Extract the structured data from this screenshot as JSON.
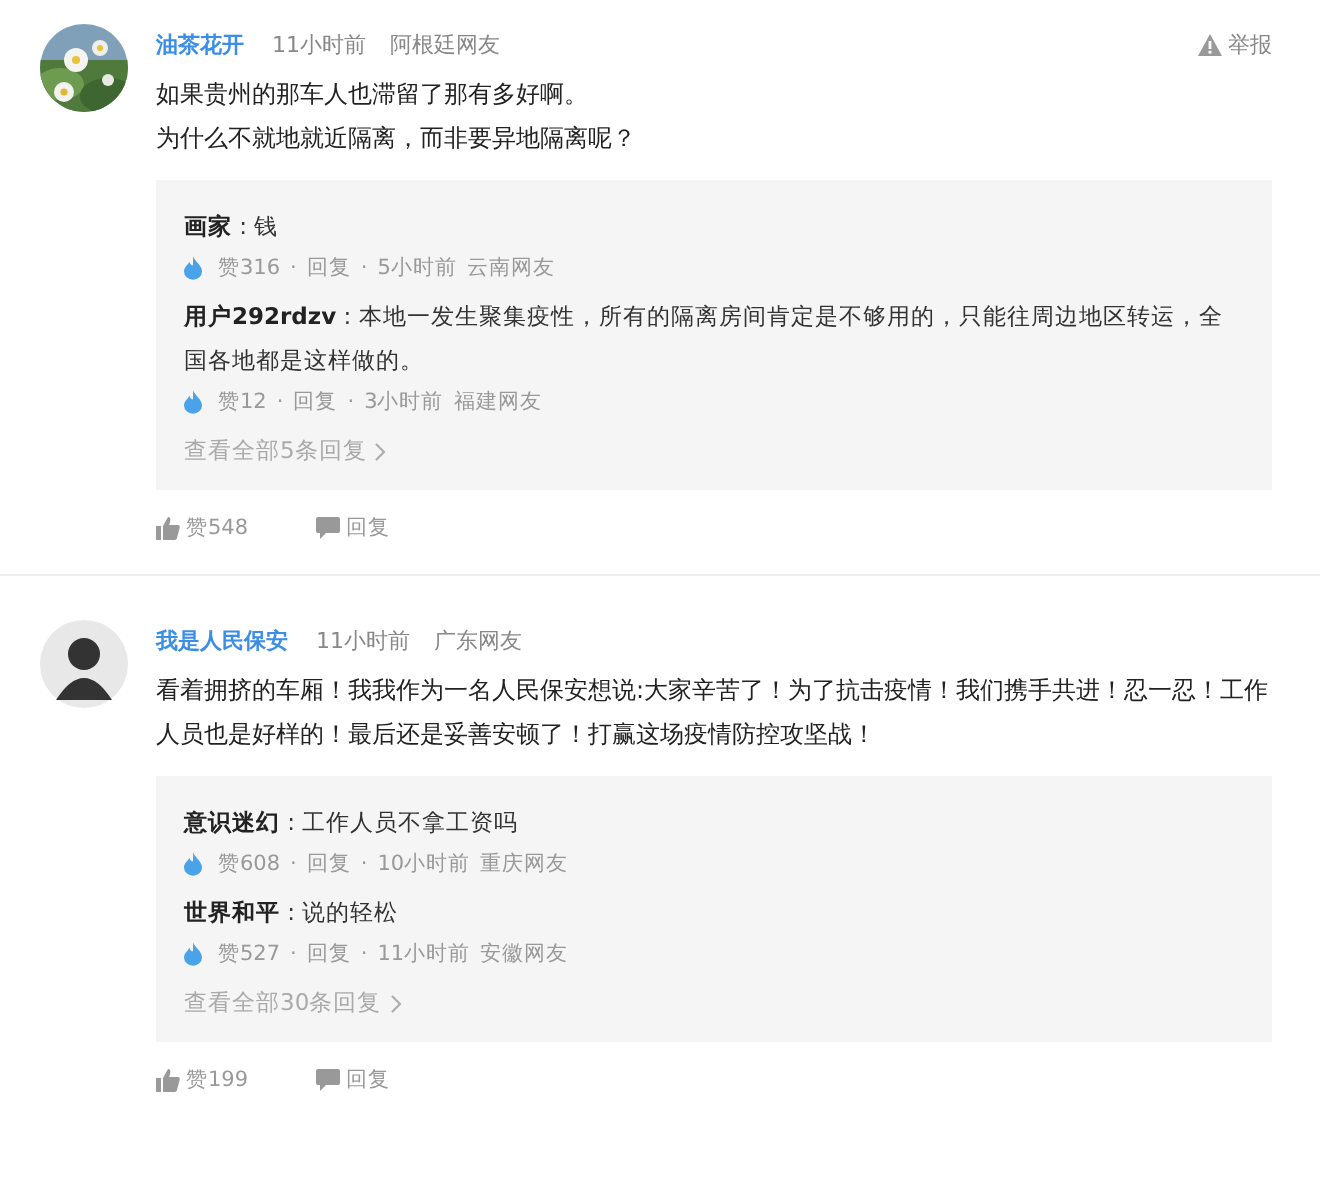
{
  "comments": [
    {
      "user": "油茶花开",
      "time": "11小时前",
      "location": "阿根廷网友",
      "report": "举报",
      "lines": [
        "如果贵州的那车人也滞留了那有多好啊。",
        "为什么不就地就近隔离，而非要异地隔离呢？"
      ],
      "replies": [
        {
          "user": "画家",
          "colon": ":",
          "text": "钱",
          "likes": "赞316",
          "sep": "·",
          "reply": "回复",
          "time": "5小时前",
          "location": "云南网友"
        },
        {
          "user": "用户292rdzv",
          "colon": ":",
          "text": "本地一发生聚集疫性，所有的隔离房间肯定是不够用的，只能往周边地区转运，全国各地都是这样做的。",
          "likes": "赞12",
          "sep": "·",
          "reply": "回复",
          "time": "3小时前",
          "location": "福建网友"
        }
      ],
      "more": "查看全部5条回复",
      "likes": "赞548",
      "reply": "回复"
    },
    {
      "avatar": {
        "kind": "silhouette"
      },
      "user": "我是人民保安",
      "time": "11小时前",
      "location": "广东网友",
      "lines": [
        "看着拥挤的车厢！我我作为一名人民保安想说:大家辛苦了！为了抗击疫情！我们携手共进！忍一忍！工作人员也是好样的！最后还是妥善安顿了！打赢这场疫情防控攻坚战！"
      ],
      "replies": [
        {
          "user": "意识迷幻",
          "colon": ":",
          "text": "工作人员不拿工资吗",
          "likes": "赞608",
          "sep": "·",
          "reply": "回复",
          "time": "10小时前",
          "location": "重庆网友"
        },
        {
          "user": "世界和平",
          "colon": ":",
          "text": "说的轻松",
          "likes": "赞527",
          "sep": "·",
          "reply": "回复",
          "time": "11小时前",
          "location": "安徽网友"
        }
      ],
      "more": "查看全部30条回复",
      "likes": "赞199",
      "reply": "回复"
    }
  ]
}
